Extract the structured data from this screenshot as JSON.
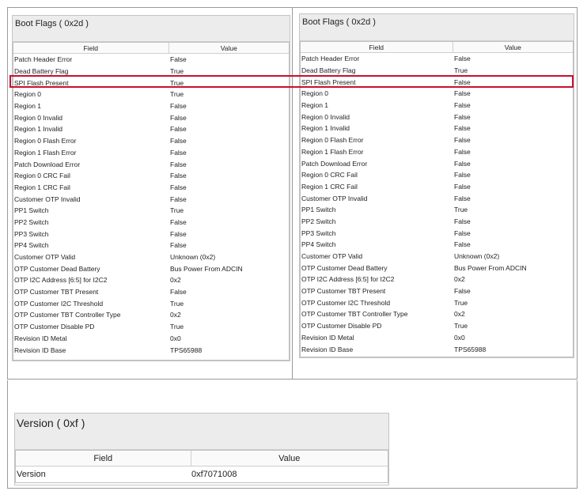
{
  "left_panel": {
    "title": "Boot Flags  ( 0x2d )",
    "columns": [
      "Field",
      "Value"
    ],
    "rows": [
      [
        "Patch Header Error",
        "False"
      ],
      [
        "Dead Battery Flag",
        "True"
      ],
      [
        "SPI Flash Present",
        "True"
      ],
      [
        "Region 0",
        "True"
      ],
      [
        "Region 1",
        "False"
      ],
      [
        "Region 0 Invalid",
        "False"
      ],
      [
        "Region 1 Invalid",
        "False"
      ],
      [
        "Region 0 Flash Error",
        "False"
      ],
      [
        "Region 1 Flash Error",
        "False"
      ],
      [
        "Patch Download Error",
        "False"
      ],
      [
        "Region 0 CRC Fail",
        "False"
      ],
      [
        "Region 1 CRC Fail",
        "False"
      ],
      [
        "Customer OTP Invalid",
        "False"
      ],
      [
        "PP1 Switch",
        "True"
      ],
      [
        "PP2 Switch",
        "False"
      ],
      [
        "PP3 Switch",
        "False"
      ],
      [
        "PP4 Switch",
        "False"
      ],
      [
        "Customer OTP Valid",
        "Unknown (0x2)"
      ],
      [
        "OTP Customer Dead Battery",
        "Bus Power From ADCIN"
      ],
      [
        "OTP I2C Address [6:5] for I2C2",
        "0x2"
      ],
      [
        "OTP Customer TBT Present",
        "False"
      ],
      [
        "OTP Customer I2C Threshold",
        "True"
      ],
      [
        "OTP Customer TBT Controller Type",
        "0x2"
      ],
      [
        "OTP Customer Disable PD",
        "True"
      ],
      [
        "Revision ID Metal",
        "0x0"
      ],
      [
        "Revision ID Base",
        "TPS65988"
      ]
    ]
  },
  "right_panel": {
    "title": "Boot Flags  ( 0x2d )",
    "columns": [
      "Field",
      "Value"
    ],
    "rows": [
      [
        "Patch Header Error",
        "False"
      ],
      [
        "Dead Battery Flag",
        "True"
      ],
      [
        "SPI Flash Present",
        "False"
      ],
      [
        "Region 0",
        "False"
      ],
      [
        "Region 1",
        "False"
      ],
      [
        "Region 0 Invalid",
        "False"
      ],
      [
        "Region 1 Invalid",
        "False"
      ],
      [
        "Region 0 Flash Error",
        "False"
      ],
      [
        "Region 1 Flash Error",
        "False"
      ],
      [
        "Patch Download Error",
        "False"
      ],
      [
        "Region 0 CRC Fail",
        "False"
      ],
      [
        "Region 1 CRC Fail",
        "False"
      ],
      [
        "Customer OTP Invalid",
        "False"
      ],
      [
        "PP1 Switch",
        "True"
      ],
      [
        "PP2 Switch",
        "False"
      ],
      [
        "PP3 Switch",
        "False"
      ],
      [
        "PP4 Switch",
        "False"
      ],
      [
        "Customer OTP Valid",
        "Unknown (0x2)"
      ],
      [
        "OTP Customer Dead Battery",
        "Bus Power From ADCIN"
      ],
      [
        "OTP I2C Address [6:5] for I2C2",
        "0x2"
      ],
      [
        "OTP Customer TBT Present",
        "False"
      ],
      [
        "OTP Customer I2C Threshold",
        "True"
      ],
      [
        "OTP Customer TBT Controller Type",
        "0x2"
      ],
      [
        "OTP Customer Disable PD",
        "True"
      ],
      [
        "Revision ID Metal",
        "0x0"
      ],
      [
        "Revision ID Base",
        "TPS65988"
      ]
    ]
  },
  "version_panel": {
    "title": "Version  ( 0xf )",
    "columns": [
      "Field",
      "Value"
    ],
    "rows": [
      [
        "Version",
        "0xf7071008"
      ]
    ]
  },
  "colors": {
    "highlight": "#c8102e",
    "header_bg": "#ececec",
    "frame_border": "#9a9a9a"
  }
}
